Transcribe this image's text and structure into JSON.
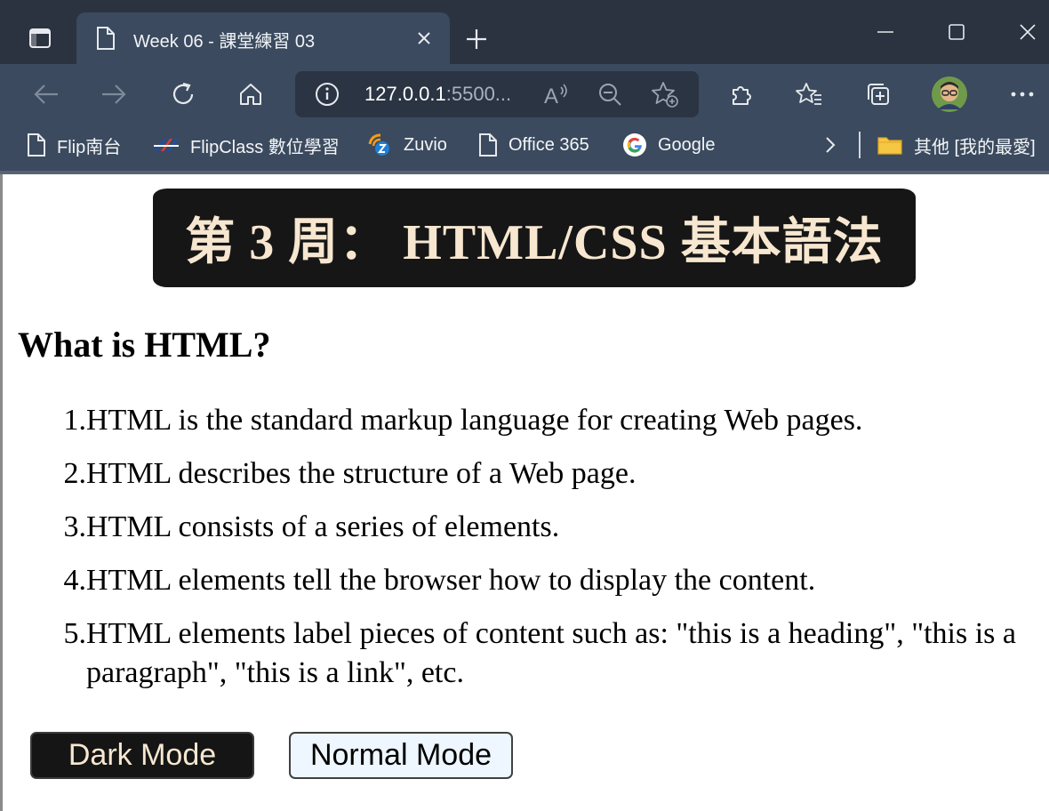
{
  "browser": {
    "tab": {
      "title": "Week 06 - 課堂練習 03"
    },
    "address": {
      "host": "127.0.0.1",
      "rest": ":5500..."
    },
    "bookmarks": [
      {
        "label": "Flip南台",
        "icon": "page-icon"
      },
      {
        "label": "FlipClass 數位學習",
        "icon": "flipclass-logo-icon"
      },
      {
        "label": "Zuvio",
        "icon": "zuvio-logo-icon"
      },
      {
        "label": "Office 365",
        "icon": "page-icon"
      },
      {
        "label": "Google",
        "icon": "google-logo-icon"
      }
    ],
    "other_favorites": "其他 [我的最愛]"
  },
  "page": {
    "banner": "第 3 周： HTML/CSS 基本語法",
    "heading": "What is HTML?",
    "items": [
      {
        "num": "1.",
        "text": "HTML is the standard markup language for creating Web pages."
      },
      {
        "num": "2.",
        "text": "HTML describes the structure of a Web page."
      },
      {
        "num": "3.",
        "text": "HTML consists of a series of elements."
      },
      {
        "num": "4.",
        "text": "HTML elements tell the browser how to display the content."
      },
      {
        "num": "5.",
        "text": "HTML elements label pieces of content such as: \"this is a heading\", \"this is a paragraph\", \"this is a link\", etc."
      }
    ],
    "buttons": {
      "dark": "Dark Mode",
      "normal": "Normal Mode"
    }
  },
  "colors": {
    "chrome_tabstrip": "#2b3340",
    "chrome_toolbar": "#3b4a5e",
    "banner_bg": "#161616",
    "banner_text": "#f7e7d0",
    "normal_button_bg": "#eef6ff"
  }
}
